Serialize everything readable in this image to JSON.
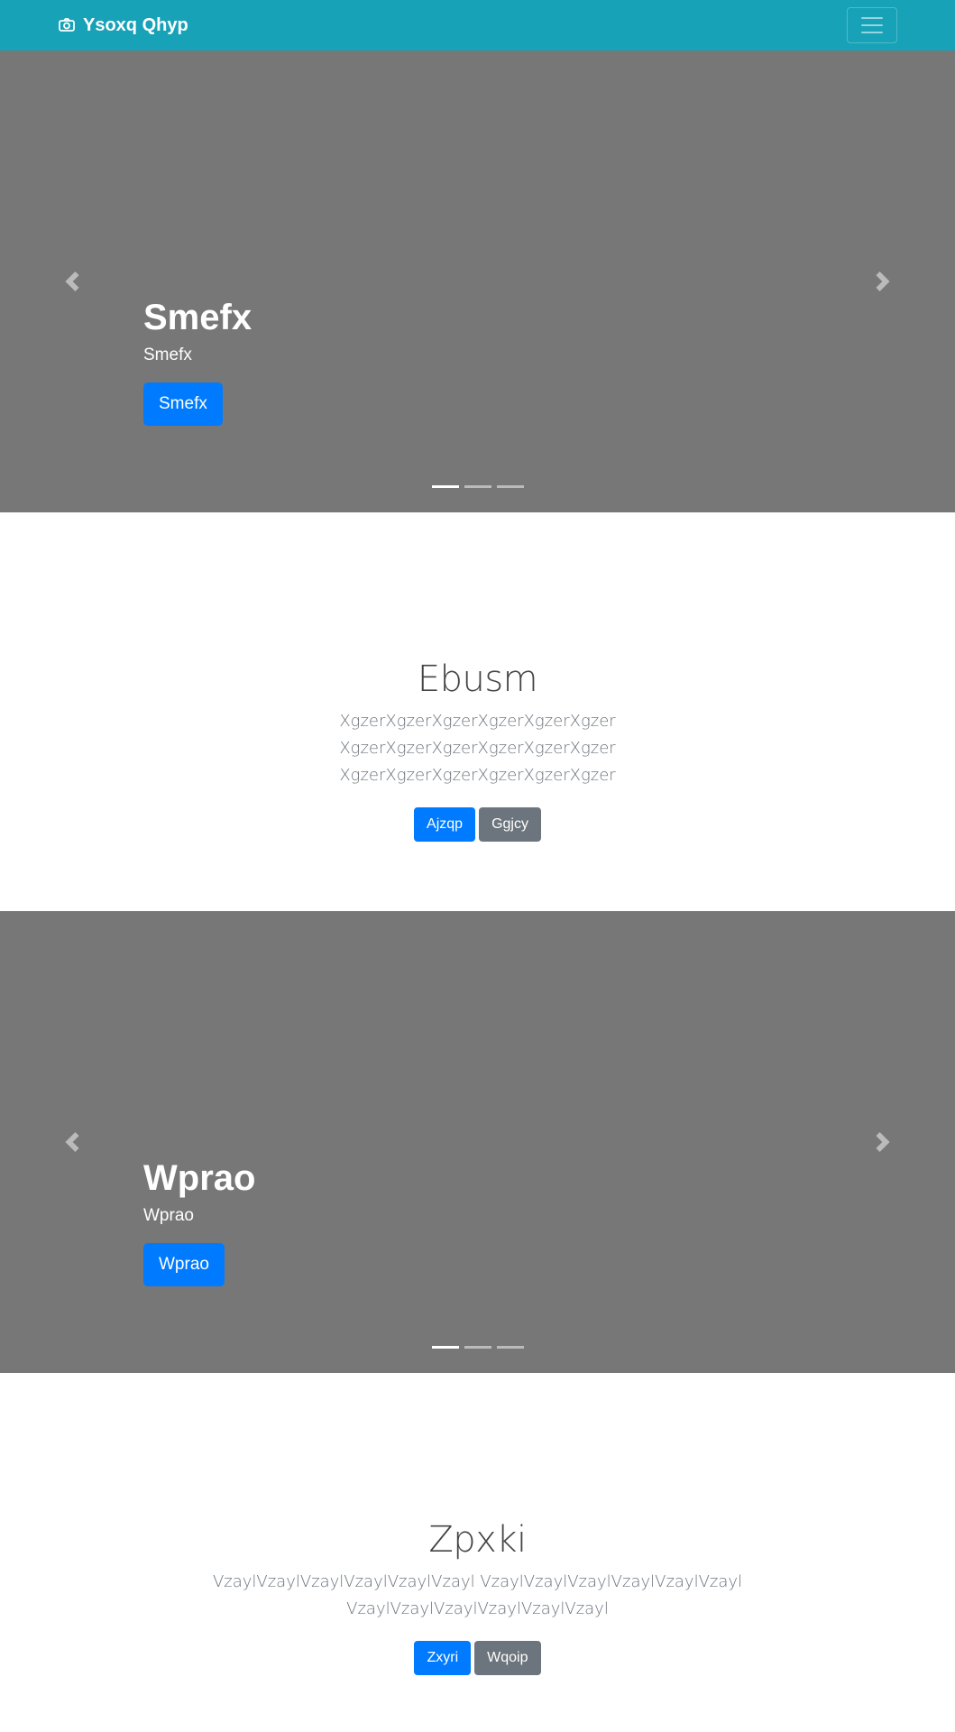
{
  "navbar": {
    "brand": "Ysoxq Qhyp",
    "brand_icon": "camera-icon",
    "toggler_icon": "hamburger-menu-icon",
    "color": "#17a2b8"
  },
  "carousels": [
    {
      "title": "Smefx",
      "subtitle": "Smefx",
      "button": "Smefx",
      "slide_count": 3,
      "active_index": 0
    },
    {
      "title": "Wprao",
      "subtitle": "Wprao",
      "button": "Wprao",
      "slide_count": 3,
      "active_index": 0
    }
  ],
  "jumbotrons": [
    {
      "title": "Ebusm",
      "lead": "XgzerXgzerXgzerXgzerXgzerXgzer XgzerXgzerXgzerXgzerXgzerXgzer XgzerXgzerXgzerXgzerXgzerXgzer",
      "primary_button": "Ajzqp",
      "secondary_button": "Ggjcy"
    },
    {
      "title": "Zpxki",
      "lead": "VzaylVzaylVzaylVzaylVzaylVzayl VzaylVzaylVzaylVzaylVzaylVzayl VzaylVzaylVzaylVzaylVzaylVzayl",
      "primary_button": "Zxyri",
      "secondary_button": "Wqoip"
    }
  ],
  "colors": {
    "carousel_bg": "#777777",
    "primary": "#007bff",
    "secondary": "#6c757d"
  }
}
